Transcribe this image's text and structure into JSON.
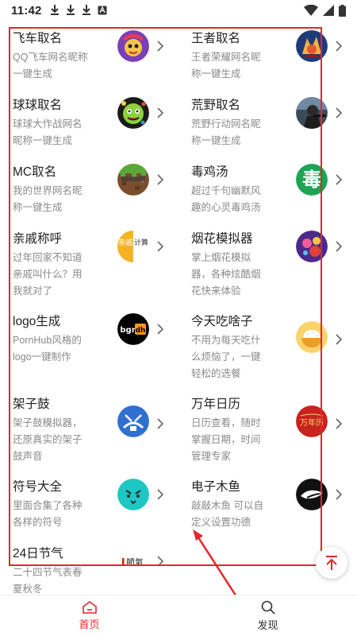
{
  "status_bar": {
    "time": "11:42"
  },
  "tools": [
    {
      "name": "飞车取名",
      "desc": "QQ飞车网名昵称一键生成",
      "icon": "qq-speed-icon"
    },
    {
      "name": "王者取名",
      "desc": "王者荣耀网名昵称一键生成",
      "icon": "honor-of-kings-icon"
    },
    {
      "name": "球球取名",
      "desc": "球球大作战网名昵称一键生成",
      "icon": "ball-battle-icon"
    },
    {
      "name": "荒野取名",
      "desc": "荒野行动网名昵称一键生成",
      "icon": "knives-out-icon"
    },
    {
      "name": "MC取名",
      "desc": "我的世界网名昵称一键生成",
      "icon": "minecraft-icon"
    },
    {
      "name": "毒鸡汤",
      "desc": "超过千句幽默风趣的心灵毒鸡汤",
      "icon": "poison-soup-icon",
      "icon_text": "毒"
    },
    {
      "name": "亲戚称呼",
      "desc": "过年回家不知道亲戚叫什么？用我就对了",
      "icon": "relative-calc-icon",
      "icon_text_a": "亲戚",
      "icon_text_b": "计算"
    },
    {
      "name": "烟花模拟器",
      "desc": "掌上烟花模拟器，各种炫酷烟花快来体验",
      "icon": "fireworks-icon"
    },
    {
      "name": "logo生成",
      "desc": "PornHub风格的logo一键制作",
      "icon": "logo-maker-icon",
      "icon_text_a": "bgr",
      "icon_text_b": "dh"
    },
    {
      "name": "今天吃啥子",
      "desc": "不用为每天吃什么烦恼了，一键轻松的选餐",
      "icon": "rice-bowl-icon"
    },
    {
      "name": "架子鼓",
      "desc": "架子鼓模拟器，还原真实的架子鼓声音",
      "icon": "drum-kit-icon"
    },
    {
      "name": "万年日历",
      "desc": "日历查看，随时掌握日期，时间管理专家",
      "icon": "calendar-icon",
      "icon_text": "万年历"
    },
    {
      "name": "符号大全",
      "desc": "里面合集了各种各样的符号",
      "icon": "symbol-face-icon"
    },
    {
      "name": "电子木鱼",
      "desc": "敲敲木鱼 可以自定义设置功德",
      "icon": "wooden-fish-icon"
    },
    {
      "name": "24日节气",
      "desc": "二十四节气表春夏秋冬",
      "icon": "solar-terms-icon",
      "icon_text": "節氣"
    }
  ],
  "colors": {
    "accent": "#e5262b",
    "desc_text": "#8a8a8a",
    "title_text": "#222222"
  },
  "nav": {
    "home_label": "首页",
    "discover_label": "发现"
  }
}
